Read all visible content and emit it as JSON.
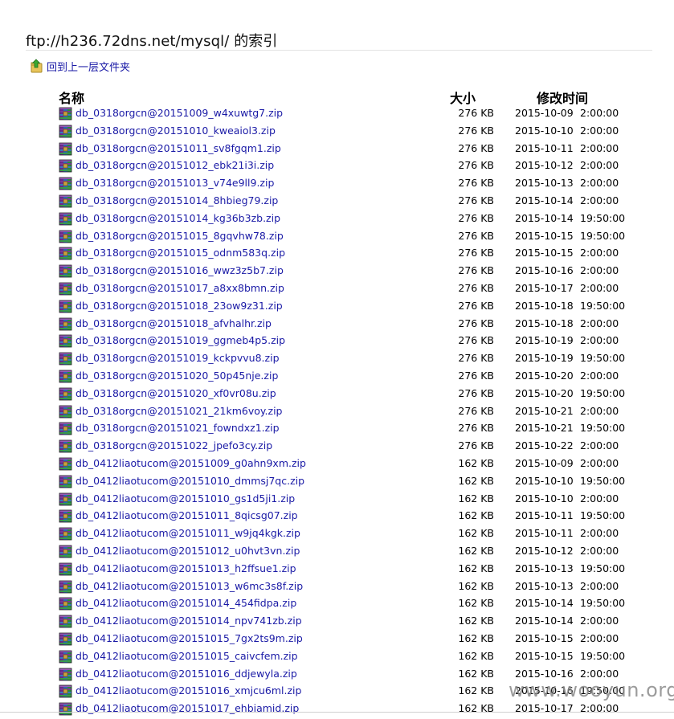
{
  "page": {
    "title": "ftp://h236.72dns.net/mysql/ 的索引",
    "up_link_label": "回到上一层文件夹",
    "up_icon": "folder-up-icon"
  },
  "columns": {
    "name": "名称",
    "size": "大小",
    "modified": "修改时间"
  },
  "file_icon": "winrar-archive-icon",
  "files": [
    {
      "name": "db_0318orgcn@20151009_w4xuwtg7.zip",
      "size": "276 KB",
      "date": "2015-10-09",
      "time": "2:00:00"
    },
    {
      "name": "db_0318orgcn@20151010_kweaiol3.zip",
      "size": "276 KB",
      "date": "2015-10-10",
      "time": "2:00:00"
    },
    {
      "name": "db_0318orgcn@20151011_sv8fgqm1.zip",
      "size": "276 KB",
      "date": "2015-10-11",
      "time": "2:00:00"
    },
    {
      "name": "db_0318orgcn@20151012_ebk21i3i.zip",
      "size": "276 KB",
      "date": "2015-10-12",
      "time": "2:00:00"
    },
    {
      "name": "db_0318orgcn@20151013_v74e9ll9.zip",
      "size": "276 KB",
      "date": "2015-10-13",
      "time": "2:00:00"
    },
    {
      "name": "db_0318orgcn@20151014_8hbieg79.zip",
      "size": "276 KB",
      "date": "2015-10-14",
      "time": "2:00:00"
    },
    {
      "name": "db_0318orgcn@20151014_kg36b3zb.zip",
      "size": "276 KB",
      "date": "2015-10-14",
      "time": "19:50:00"
    },
    {
      "name": "db_0318orgcn@20151015_8gqvhw78.zip",
      "size": "276 KB",
      "date": "2015-10-15",
      "time": "19:50:00"
    },
    {
      "name": "db_0318orgcn@20151015_odnm583q.zip",
      "size": "276 KB",
      "date": "2015-10-15",
      "time": "2:00:00"
    },
    {
      "name": "db_0318orgcn@20151016_wwz3z5b7.zip",
      "size": "276 KB",
      "date": "2015-10-16",
      "time": "2:00:00"
    },
    {
      "name": "db_0318orgcn@20151017_a8xx8bmn.zip",
      "size": "276 KB",
      "date": "2015-10-17",
      "time": "2:00:00"
    },
    {
      "name": "db_0318orgcn@20151018_23ow9z31.zip",
      "size": "276 KB",
      "date": "2015-10-18",
      "time": "19:50:00"
    },
    {
      "name": "db_0318orgcn@20151018_afvhalhr.zip",
      "size": "276 KB",
      "date": "2015-10-18",
      "time": "2:00:00"
    },
    {
      "name": "db_0318orgcn@20151019_ggmeb4p5.zip",
      "size": "276 KB",
      "date": "2015-10-19",
      "time": "2:00:00"
    },
    {
      "name": "db_0318orgcn@20151019_kckpvvu8.zip",
      "size": "276 KB",
      "date": "2015-10-19",
      "time": "19:50:00"
    },
    {
      "name": "db_0318orgcn@20151020_50p45nje.zip",
      "size": "276 KB",
      "date": "2015-10-20",
      "time": "2:00:00"
    },
    {
      "name": "db_0318orgcn@20151020_xf0vr08u.zip",
      "size": "276 KB",
      "date": "2015-10-20",
      "time": "19:50:00"
    },
    {
      "name": "db_0318orgcn@20151021_21km6voy.zip",
      "size": "276 KB",
      "date": "2015-10-21",
      "time": "2:00:00"
    },
    {
      "name": "db_0318orgcn@20151021_fowndxz1.zip",
      "size": "276 KB",
      "date": "2015-10-21",
      "time": "19:50:00"
    },
    {
      "name": "db_0318orgcn@20151022_jpefo3cy.zip",
      "size": "276 KB",
      "date": "2015-10-22",
      "time": "2:00:00"
    },
    {
      "name": "db_0412liaotucom@20151009_g0ahn9xm.zip",
      "size": "162 KB",
      "date": "2015-10-09",
      "time": "2:00:00"
    },
    {
      "name": "db_0412liaotucom@20151010_dmmsj7qc.zip",
      "size": "162 KB",
      "date": "2015-10-10",
      "time": "19:50:00"
    },
    {
      "name": "db_0412liaotucom@20151010_gs1d5ji1.zip",
      "size": "162 KB",
      "date": "2015-10-10",
      "time": "2:00:00"
    },
    {
      "name": "db_0412liaotucom@20151011_8qicsg07.zip",
      "size": "162 KB",
      "date": "2015-10-11",
      "time": "19:50:00"
    },
    {
      "name": "db_0412liaotucom@20151011_w9jq4kgk.zip",
      "size": "162 KB",
      "date": "2015-10-11",
      "time": "2:00:00"
    },
    {
      "name": "db_0412liaotucom@20151012_u0hvt3vn.zip",
      "size": "162 KB",
      "date": "2015-10-12",
      "time": "2:00:00"
    },
    {
      "name": "db_0412liaotucom@20151013_h2ffsue1.zip",
      "size": "162 KB",
      "date": "2015-10-13",
      "time": "19:50:00"
    },
    {
      "name": "db_0412liaotucom@20151013_w6mc3s8f.zip",
      "size": "162 KB",
      "date": "2015-10-13",
      "time": "2:00:00"
    },
    {
      "name": "db_0412liaotucom@20151014_454fidpa.zip",
      "size": "162 KB",
      "date": "2015-10-14",
      "time": "19:50:00"
    },
    {
      "name": "db_0412liaotucom@20151014_npv741zb.zip",
      "size": "162 KB",
      "date": "2015-10-14",
      "time": "2:00:00"
    },
    {
      "name": "db_0412liaotucom@20151015_7gx2ts9m.zip",
      "size": "162 KB",
      "date": "2015-10-15",
      "time": "2:00:00"
    },
    {
      "name": "db_0412liaotucom@20151015_caivcfem.zip",
      "size": "162 KB",
      "date": "2015-10-15",
      "time": "19:50:00"
    },
    {
      "name": "db_0412liaotucom@20151016_ddjewyla.zip",
      "size": "162 KB",
      "date": "2015-10-16",
      "time": "2:00:00"
    },
    {
      "name": "db_0412liaotucom@20151016_xmjcu6ml.zip",
      "size": "162 KB",
      "date": "2015-10-16",
      "time": "19:50:00"
    },
    {
      "name": "db_0412liaotucom@20151017_ehbiamid.zip",
      "size": "162 KB",
      "date": "2015-10-17",
      "time": "2:00:00"
    }
  ],
  "watermark": "www.wooyun.org"
}
